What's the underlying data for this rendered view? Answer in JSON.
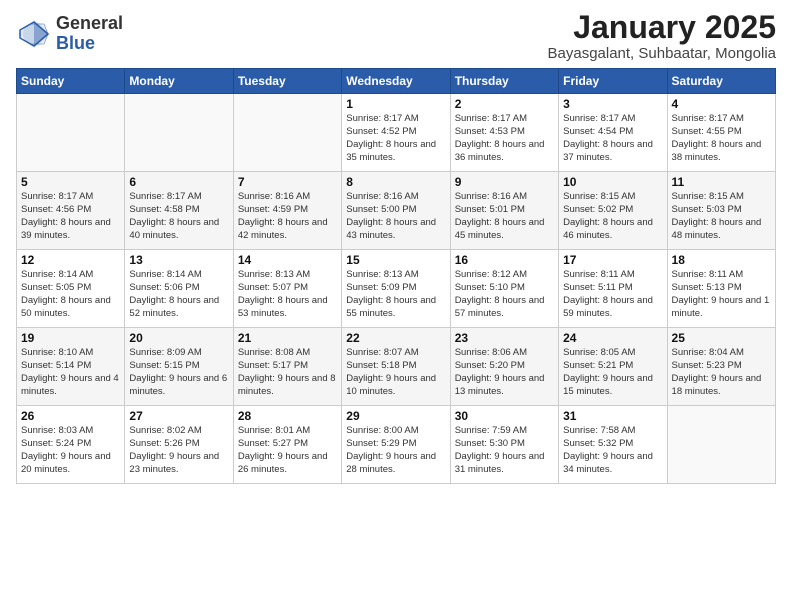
{
  "header": {
    "logo_general": "General",
    "logo_blue": "Blue",
    "month": "January 2025",
    "location": "Bayasgalant, Suhbaatar, Mongolia"
  },
  "weekdays": [
    "Sunday",
    "Monday",
    "Tuesday",
    "Wednesday",
    "Thursday",
    "Friday",
    "Saturday"
  ],
  "weeks": [
    [
      {
        "day": "",
        "info": ""
      },
      {
        "day": "",
        "info": ""
      },
      {
        "day": "",
        "info": ""
      },
      {
        "day": "1",
        "info": "Sunrise: 8:17 AM\nSunset: 4:52 PM\nDaylight: 8 hours and 35 minutes."
      },
      {
        "day": "2",
        "info": "Sunrise: 8:17 AM\nSunset: 4:53 PM\nDaylight: 8 hours and 36 minutes."
      },
      {
        "day": "3",
        "info": "Sunrise: 8:17 AM\nSunset: 4:54 PM\nDaylight: 8 hours and 37 minutes."
      },
      {
        "day": "4",
        "info": "Sunrise: 8:17 AM\nSunset: 4:55 PM\nDaylight: 8 hours and 38 minutes."
      }
    ],
    [
      {
        "day": "5",
        "info": "Sunrise: 8:17 AM\nSunset: 4:56 PM\nDaylight: 8 hours and 39 minutes."
      },
      {
        "day": "6",
        "info": "Sunrise: 8:17 AM\nSunset: 4:58 PM\nDaylight: 8 hours and 40 minutes."
      },
      {
        "day": "7",
        "info": "Sunrise: 8:16 AM\nSunset: 4:59 PM\nDaylight: 8 hours and 42 minutes."
      },
      {
        "day": "8",
        "info": "Sunrise: 8:16 AM\nSunset: 5:00 PM\nDaylight: 8 hours and 43 minutes."
      },
      {
        "day": "9",
        "info": "Sunrise: 8:16 AM\nSunset: 5:01 PM\nDaylight: 8 hours and 45 minutes."
      },
      {
        "day": "10",
        "info": "Sunrise: 8:15 AM\nSunset: 5:02 PM\nDaylight: 8 hours and 46 minutes."
      },
      {
        "day": "11",
        "info": "Sunrise: 8:15 AM\nSunset: 5:03 PM\nDaylight: 8 hours and 48 minutes."
      }
    ],
    [
      {
        "day": "12",
        "info": "Sunrise: 8:14 AM\nSunset: 5:05 PM\nDaylight: 8 hours and 50 minutes."
      },
      {
        "day": "13",
        "info": "Sunrise: 8:14 AM\nSunset: 5:06 PM\nDaylight: 8 hours and 52 minutes."
      },
      {
        "day": "14",
        "info": "Sunrise: 8:13 AM\nSunset: 5:07 PM\nDaylight: 8 hours and 53 minutes."
      },
      {
        "day": "15",
        "info": "Sunrise: 8:13 AM\nSunset: 5:09 PM\nDaylight: 8 hours and 55 minutes."
      },
      {
        "day": "16",
        "info": "Sunrise: 8:12 AM\nSunset: 5:10 PM\nDaylight: 8 hours and 57 minutes."
      },
      {
        "day": "17",
        "info": "Sunrise: 8:11 AM\nSunset: 5:11 PM\nDaylight: 8 hours and 59 minutes."
      },
      {
        "day": "18",
        "info": "Sunrise: 8:11 AM\nSunset: 5:13 PM\nDaylight: 9 hours and 1 minute."
      }
    ],
    [
      {
        "day": "19",
        "info": "Sunrise: 8:10 AM\nSunset: 5:14 PM\nDaylight: 9 hours and 4 minutes."
      },
      {
        "day": "20",
        "info": "Sunrise: 8:09 AM\nSunset: 5:15 PM\nDaylight: 9 hours and 6 minutes."
      },
      {
        "day": "21",
        "info": "Sunrise: 8:08 AM\nSunset: 5:17 PM\nDaylight: 9 hours and 8 minutes."
      },
      {
        "day": "22",
        "info": "Sunrise: 8:07 AM\nSunset: 5:18 PM\nDaylight: 9 hours and 10 minutes."
      },
      {
        "day": "23",
        "info": "Sunrise: 8:06 AM\nSunset: 5:20 PM\nDaylight: 9 hours and 13 minutes."
      },
      {
        "day": "24",
        "info": "Sunrise: 8:05 AM\nSunset: 5:21 PM\nDaylight: 9 hours and 15 minutes."
      },
      {
        "day": "25",
        "info": "Sunrise: 8:04 AM\nSunset: 5:23 PM\nDaylight: 9 hours and 18 minutes."
      }
    ],
    [
      {
        "day": "26",
        "info": "Sunrise: 8:03 AM\nSunset: 5:24 PM\nDaylight: 9 hours and 20 minutes."
      },
      {
        "day": "27",
        "info": "Sunrise: 8:02 AM\nSunset: 5:26 PM\nDaylight: 9 hours and 23 minutes."
      },
      {
        "day": "28",
        "info": "Sunrise: 8:01 AM\nSunset: 5:27 PM\nDaylight: 9 hours and 26 minutes."
      },
      {
        "day": "29",
        "info": "Sunrise: 8:00 AM\nSunset: 5:29 PM\nDaylight: 9 hours and 28 minutes."
      },
      {
        "day": "30",
        "info": "Sunrise: 7:59 AM\nSunset: 5:30 PM\nDaylight: 9 hours and 31 minutes."
      },
      {
        "day": "31",
        "info": "Sunrise: 7:58 AM\nSunset: 5:32 PM\nDaylight: 9 hours and 34 minutes."
      },
      {
        "day": "",
        "info": ""
      }
    ]
  ]
}
